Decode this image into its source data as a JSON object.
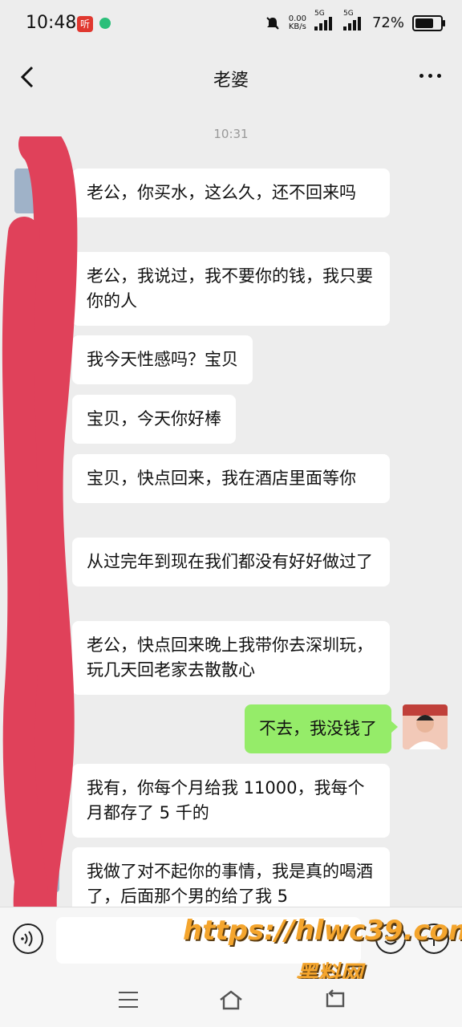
{
  "status_bar": {
    "time": "10:48",
    "app_badge": "听",
    "net_speed_value": "0.00",
    "net_speed_unit": "KB/s",
    "network_1": "5G",
    "network_2": "5G",
    "battery": "72%",
    "battery_level": 0.72
  },
  "header": {
    "title": "老婆"
  },
  "chat": {
    "timestamp": "10:31",
    "messages": [
      {
        "direction": "in",
        "text": "老公，你买水，这么久，还不回来吗"
      },
      {
        "direction": "in",
        "text": "老公，我说过，我不要你的钱，我只要你的人"
      },
      {
        "direction": "in",
        "text": "我今天性感吗？宝贝"
      },
      {
        "direction": "in",
        "text": "宝贝，今天你好棒"
      },
      {
        "direction": "in",
        "text": "宝贝，快点回来，我在酒店里面等你"
      },
      {
        "direction": "in",
        "text": "从过完年到现在我们都没有好好做过了"
      },
      {
        "direction": "in",
        "text": "老公，快点回来晚上我带你去深圳玩，玩几天回老家去散散心"
      },
      {
        "direction": "out",
        "text": "不去，我没钱了"
      },
      {
        "direction": "in",
        "text": "我有，你每个月给我 11000，我每个月都存了 5 千的"
      },
      {
        "direction": "in",
        "text": "我做了对不起你的事情，我是真的喝酒了，后面那个男的给了我 5"
      }
    ]
  },
  "input_bar": {
    "placeholder": ""
  },
  "watermark": {
    "url": "https://hlwc39.com",
    "site_name": "黑料网"
  },
  "colors": {
    "background": "#ededed",
    "incoming_bubble": "#ffffff",
    "outgoing_bubble": "#95ec69",
    "redaction": "#e0415a",
    "watermark": "#f4a52d"
  }
}
